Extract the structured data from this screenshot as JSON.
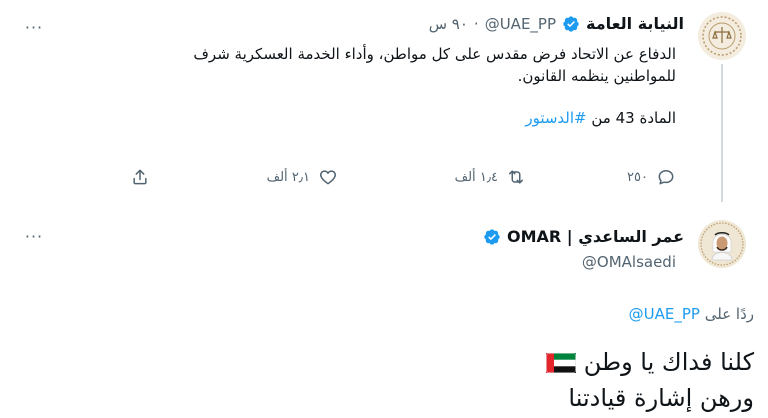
{
  "tweet1": {
    "display_name": "النيابة العامة",
    "handle": "@UAE_PP",
    "separator": "·",
    "time": "٩٠ س",
    "text_line1": "الدفاع عن الاتحاد فرض مقدس على كل مواطن، وأداء الخدمة العسكرية شرف",
    "text_line2": "للمواطنين ينظمه القانون.",
    "text_line3_prefix": "المادة 43 من ",
    "hashtag": "#الدستور",
    "replies": "٢٥٠",
    "retweets": "١٫٤ ألف",
    "likes": "٢٫١ ألف",
    "more_label": "···",
    "avatar_icon": "public-prosecution-emblem-icon"
  },
  "tweet2": {
    "display_name": "عمر الساعدي | OMAR",
    "handle": "@OMAlsaedi",
    "more_label": "···",
    "reply_prefix": "ردًا على ",
    "reply_mention": "@UAE_PP",
    "line1": "كلنا فداك يا وطن",
    "line2": "ورهن إشارة قيادتنا",
    "avatar_icon": "user-portrait-icon"
  },
  "colors": {
    "accent": "#1d9bf0",
    "muted": "#536471",
    "text": "#0f1419",
    "verified": "#1d9bf0"
  }
}
